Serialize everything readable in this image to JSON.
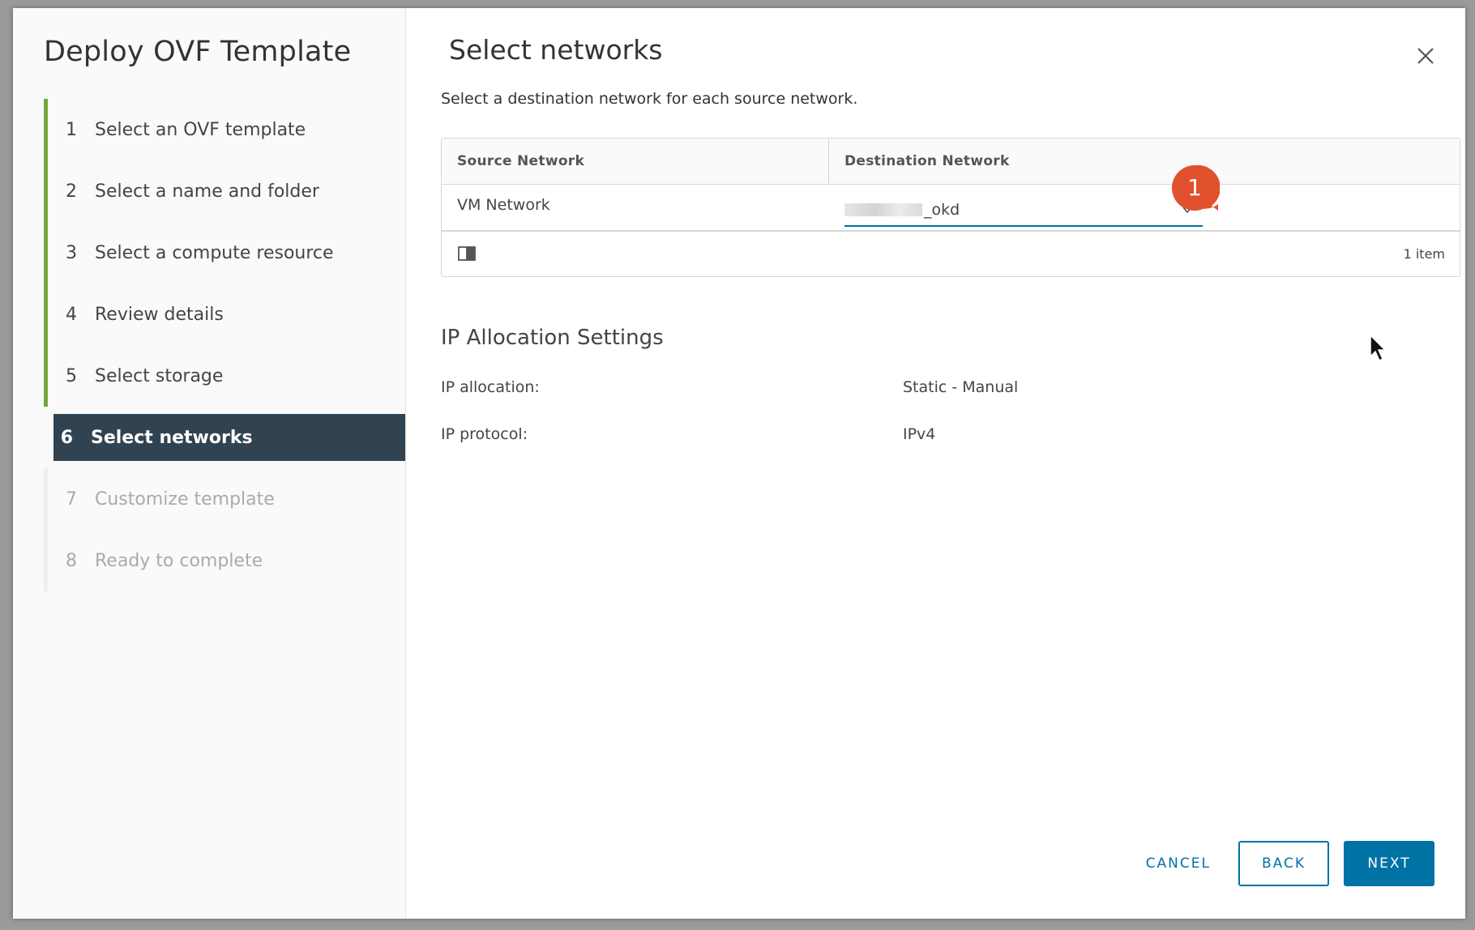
{
  "wizard": {
    "title": "Deploy OVF Template",
    "steps": [
      {
        "num": "1",
        "label": "Select an OVF template",
        "state": "done"
      },
      {
        "num": "2",
        "label": "Select a name and folder",
        "state": "done"
      },
      {
        "num": "3",
        "label": "Select a compute resource",
        "state": "done"
      },
      {
        "num": "4",
        "label": "Review details",
        "state": "done"
      },
      {
        "num": "5",
        "label": "Select storage",
        "state": "done"
      },
      {
        "num": "6",
        "label": "Select networks",
        "state": "active"
      },
      {
        "num": "7",
        "label": "Customize template",
        "state": "future"
      },
      {
        "num": "8",
        "label": "Ready to complete",
        "state": "future"
      }
    ]
  },
  "page": {
    "title": "Select networks",
    "subtitle": "Select a destination network for each source network."
  },
  "grid": {
    "headers": {
      "source": "Source Network",
      "destination": "Destination Network"
    },
    "rows": [
      {
        "source": "VM Network",
        "destination_suffix": "_okd"
      }
    ],
    "footer_count": "1 item"
  },
  "callout": {
    "number": "1",
    "color": "#e2512e"
  },
  "ip_settings": {
    "title": "IP Allocation Settings",
    "allocation_label": "IP allocation:",
    "allocation_value": "Static - Manual",
    "protocol_label": "IP protocol:",
    "protocol_value": "IPv4"
  },
  "buttons": {
    "cancel": "CANCEL",
    "back": "BACK",
    "next": "NEXT"
  },
  "colors": {
    "accent": "#0072a3",
    "step_done": "#73a739",
    "step_active_bg": "#314351"
  },
  "icons": {
    "close": "close-icon",
    "chevron": "chevron-down-icon",
    "column_toggle": "column-toggle-icon",
    "cursor": "mouse-pointer-icon"
  }
}
